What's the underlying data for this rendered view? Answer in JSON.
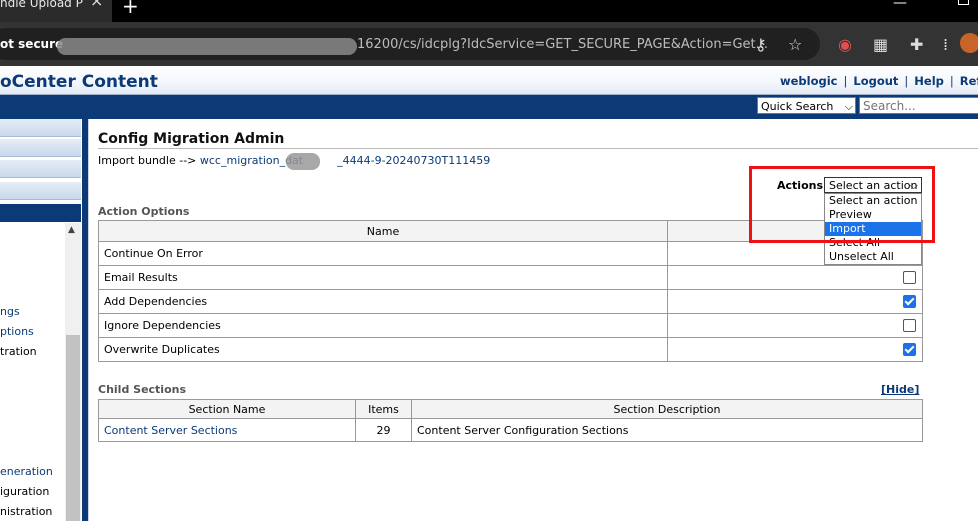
{
  "browser": {
    "tab_title": "ndle Upload P",
    "tab_close": "×",
    "new_tab": "+",
    "security_label": "ot secure",
    "url_visible": "16200/cs/idcplg?IdcService=GET_SECURE_PAGE&Action=Get..."
  },
  "app": {
    "title": "oCenter Content",
    "top_links": [
      "weblogic",
      "Logout",
      "Help",
      "Refresh P"
    ],
    "quick_search_select": "Quick Search",
    "search_placeholder": "Search..."
  },
  "left_nav": {
    "items": [
      "ngs",
      "ptions",
      "tration",
      "eneration",
      "iguration",
      "nistration"
    ]
  },
  "main": {
    "page_title": "Config Migration Admin",
    "import_prefix": "Import bundle -->",
    "bundle_name_start": "wcc_migration_dat",
    "bundle_name_end": "_4444-9-20240730T111459",
    "actions_label": "Actions:",
    "actions_selected": "Select an action",
    "action_options": [
      "Select an action",
      "Preview",
      "Import",
      "Select All",
      "Unselect All"
    ],
    "action_highlighted": "Import",
    "action_options_section_label": "Action Options",
    "options_table": {
      "header_name": "Name",
      "rows": [
        {
          "name": "Continue On Error",
          "checked": null
        },
        {
          "name": "Email Results",
          "checked": false
        },
        {
          "name": "Add Dependencies",
          "checked": true
        },
        {
          "name": "Ignore Dependencies",
          "checked": false
        },
        {
          "name": "Overwrite Duplicates",
          "checked": true
        }
      ]
    },
    "child_sections_label": "Child Sections",
    "hide_link": "[Hide]",
    "child_table": {
      "headers": [
        "Section Name",
        "Items",
        "Section Description"
      ],
      "rows": [
        {
          "name": "Content Server Sections",
          "items": "29",
          "description": "Content Server Configuration Sections"
        }
      ]
    }
  },
  "colors": {
    "brand_navy": "#0b3a77",
    "highlight": "#1a73e8",
    "annotation_red": "#ee1111"
  }
}
